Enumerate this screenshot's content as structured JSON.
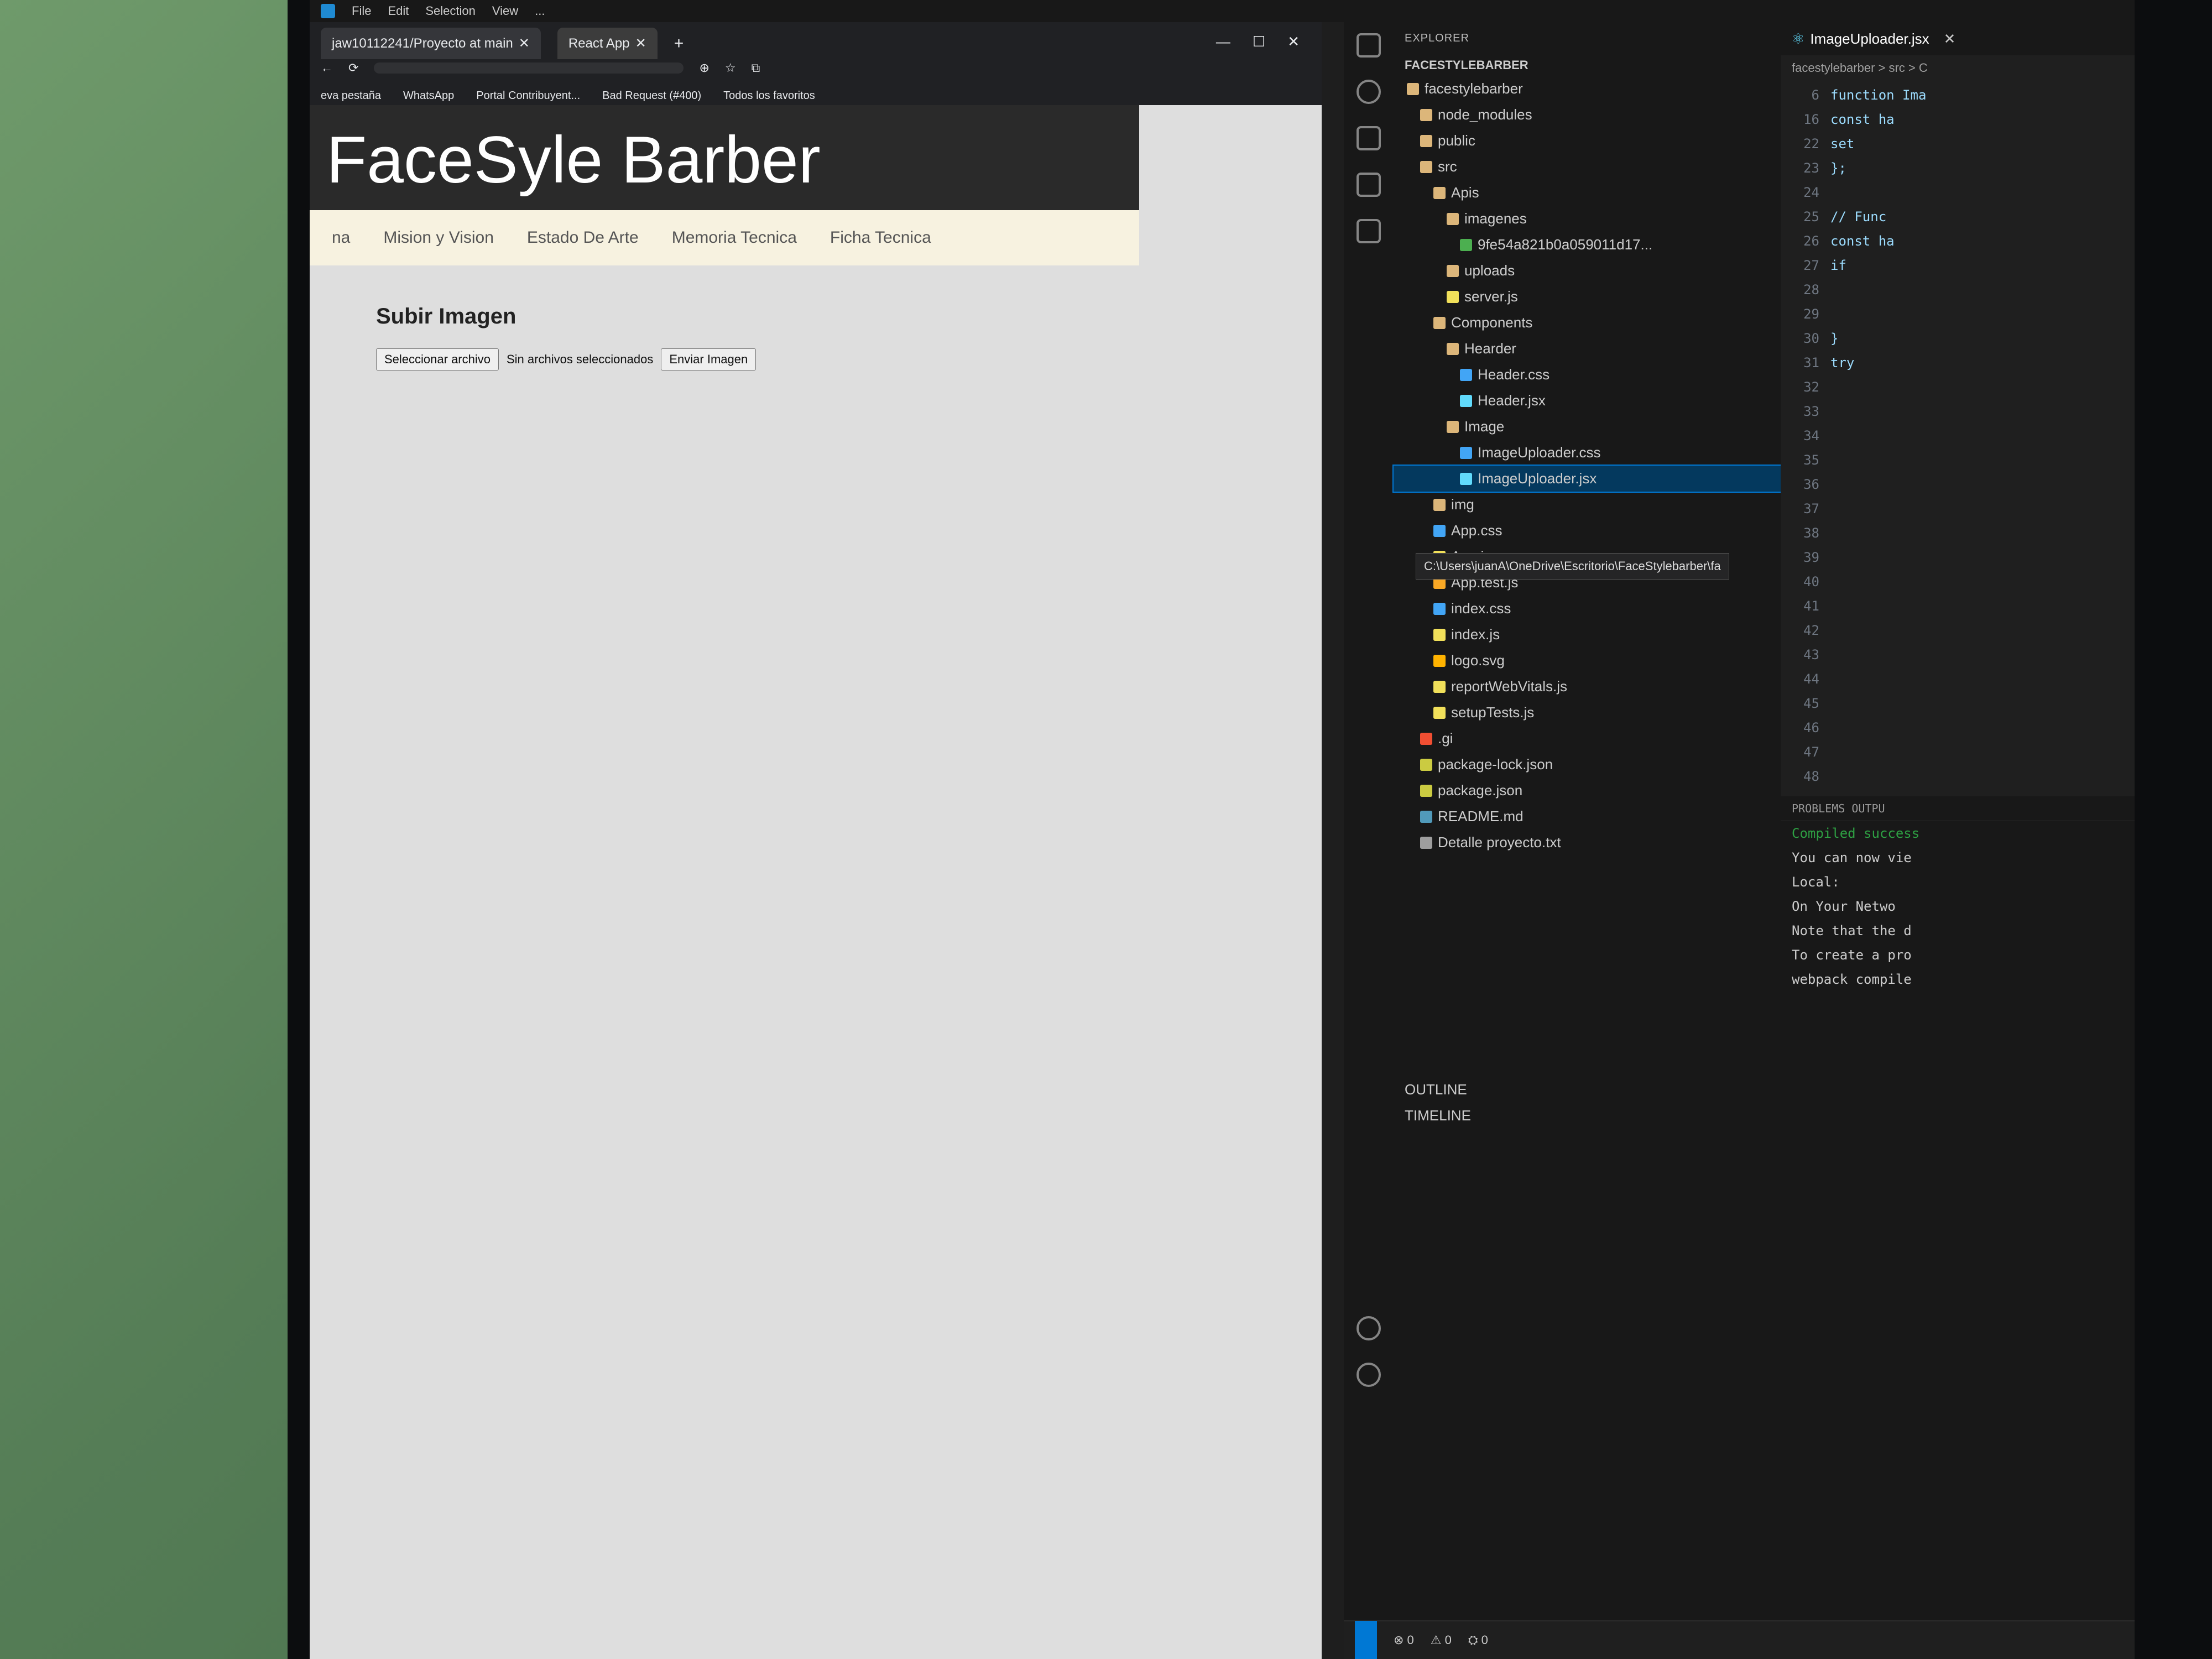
{
  "vscode": {
    "menu": [
      "File",
      "Edit",
      "Selection",
      "View",
      "..."
    ],
    "explorer": {
      "header": "EXPLORER",
      "root": "FACESTYLEBARBER",
      "items": [
        {
          "label": "facestylebarber",
          "type": "folder-open"
        },
        {
          "label": "node_modules",
          "type": "folder"
        },
        {
          "label": "public",
          "type": "folder"
        },
        {
          "label": "src",
          "type": "folder-open"
        },
        {
          "label": "Apis",
          "type": "folder-open"
        },
        {
          "label": "imagenes",
          "type": "folder-open"
        },
        {
          "label": "9fe54a821b0a059011d17...",
          "type": "file"
        },
        {
          "label": "uploads",
          "type": "folder"
        },
        {
          "label": "server.js",
          "type": "js"
        },
        {
          "label": "Components",
          "type": "folder-open"
        },
        {
          "label": "Hearder",
          "type": "folder-open"
        },
        {
          "label": "Header.css",
          "type": "css"
        },
        {
          "label": "Header.jsx",
          "type": "react"
        },
        {
          "label": "Image",
          "type": "folder-open"
        },
        {
          "label": "ImageUploader.css",
          "type": "css"
        },
        {
          "label": "ImageUploader.jsx",
          "type": "react",
          "selected": true
        },
        {
          "label": "img",
          "type": "folder"
        },
        {
          "label": "App.css",
          "type": "css"
        },
        {
          "label": "App.js",
          "type": "js"
        },
        {
          "label": "App.test.js",
          "type": "test"
        },
        {
          "label": "index.css",
          "type": "css"
        },
        {
          "label": "index.js",
          "type": "js"
        },
        {
          "label": "logo.svg",
          "type": "svg"
        },
        {
          "label": "reportWebVitals.js",
          "type": "js"
        },
        {
          "label": "setupTests.js",
          "type": "js"
        },
        {
          "label": ".gi",
          "type": "git"
        },
        {
          "label": "package-lock.json",
          "type": "json"
        },
        {
          "label": "package.json",
          "type": "json"
        },
        {
          "label": "README.md",
          "type": "md"
        },
        {
          "label": "Detalle proyecto.txt",
          "type": "txt"
        }
      ],
      "outline": "OUTLINE",
      "timeline": "TIMELINE"
    },
    "path_tooltip": "C:\\Users\\juanA\\OneDrive\\Escritorio\\FaceStylebarber\\fa",
    "editor": {
      "tab": "ImageUploader.jsx",
      "breadcrumb": "facestylebarber > src > C",
      "lines": [
        {
          "n": "6",
          "code": "function Ima"
        },
        {
          "n": "16",
          "code": "  const ha"
        },
        {
          "n": "22",
          "code": "    set"
        },
        {
          "n": "23",
          "code": "  };"
        },
        {
          "n": "24",
          "code": ""
        },
        {
          "n": "25",
          "code": "  // Func"
        },
        {
          "n": "26",
          "code": "  const ha"
        },
        {
          "n": "27",
          "code": "    if"
        },
        {
          "n": "28",
          "code": ""
        },
        {
          "n": "29",
          "code": ""
        },
        {
          "n": "30",
          "code": "    }"
        },
        {
          "n": "31",
          "code": "    try"
        },
        {
          "n": "32",
          "code": ""
        },
        {
          "n": "33",
          "code": ""
        },
        {
          "n": "34",
          "code": ""
        },
        {
          "n": "35",
          "code": ""
        },
        {
          "n": "36",
          "code": ""
        },
        {
          "n": "37",
          "code": ""
        },
        {
          "n": "38",
          "code": ""
        },
        {
          "n": "39",
          "code": ""
        },
        {
          "n": "40",
          "code": ""
        },
        {
          "n": "41",
          "code": ""
        },
        {
          "n": "42",
          "code": ""
        },
        {
          "n": "43",
          "code": ""
        },
        {
          "n": "44",
          "code": ""
        },
        {
          "n": "45",
          "code": ""
        },
        {
          "n": "46",
          "code": ""
        },
        {
          "n": "47",
          "code": ""
        },
        {
          "n": "48",
          "code": ""
        }
      ]
    },
    "terminal": {
      "tabs": "PROBLEMS   OUTPU",
      "lines": [
        {
          "text": "Compiled success",
          "color": "#2ea043"
        },
        {
          "text": "You can now vie",
          "color": "#cccccc"
        },
        {
          "text": "  Local:",
          "color": "#cccccc"
        },
        {
          "text": "  On Your Netwo",
          "color": "#cccccc"
        },
        {
          "text": "Note that the d",
          "color": "#cccccc"
        },
        {
          "text": "To create a pro",
          "color": "#cccccc"
        },
        {
          "text": "webpack compile",
          "color": "#cccccc"
        }
      ]
    },
    "status": {
      "errors": "0",
      "warnings": "0",
      "ports": "0"
    }
  },
  "browser": {
    "tabs": [
      {
        "label": "jaw10112241/Proyecto at main",
        "active": false
      },
      {
        "label": "React App",
        "active": true
      }
    ],
    "new_tab": "+",
    "bookmarks": [
      "eva pestaña",
      "WhatsApp",
      "Portal Contribuyent...",
      "Bad Request (#400)",
      "Todos los favoritos"
    ],
    "site": {
      "title": "FaceSyle Barber",
      "nav": [
        "na",
        "Mision y Vision",
        "Estado De Arte",
        "Memoria Tecnica",
        "Ficha Tecnica"
      ],
      "upload_heading": "Subir Imagen",
      "choose_file": "Seleccionar archivo",
      "no_file": "Sin archivos seleccionados",
      "submit": "Enviar Imagen"
    }
  }
}
